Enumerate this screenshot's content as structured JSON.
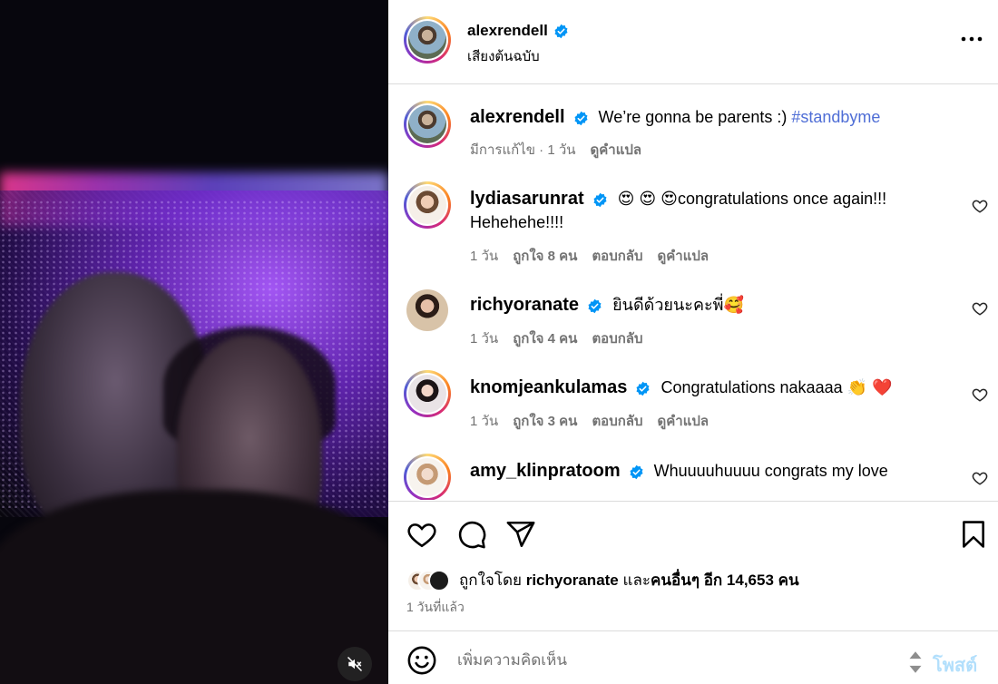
{
  "post": {
    "author": "alexrendell",
    "audio_label": "เสียงต้นฉบับ"
  },
  "caption": {
    "username": "alexrendell",
    "text": "We’re gonna be parents :) ",
    "hashtag": "#standbyme",
    "edited_label": "มีการแก้ไข",
    "time": "1 วัน",
    "translate": "ดูคำแปล"
  },
  "comments": [
    {
      "username": "lydiasarunrat",
      "emoji": "😍 😍 😍",
      "text": "congratulations once again!!! Hehehehe!!!!",
      "time": "1 วัน",
      "likes": "ถูกใจ 8 คน",
      "reply": "ตอบกลับ",
      "translate": "ดูคำแปล"
    },
    {
      "username": "richyoranate",
      "text": "ยินดีด้วยนะคะพี่",
      "emoji": "🥰",
      "time": "1 วัน",
      "likes": "ถูกใจ 4 คน",
      "reply": "ตอบกลับ"
    },
    {
      "username": "knomjeankulamas",
      "text": "Congratulations nakaaaa ",
      "emoji": "👏 ❤️",
      "time": "1 วัน",
      "likes": "ถูกใจ 3 คน",
      "reply": "ตอบกลับ",
      "translate": "ดูคำแปล"
    },
    {
      "username": "amy_klinpratoom",
      "text": "Whuuuuhuuuu congrats my love"
    }
  ],
  "likes": {
    "prefix": "ถูกใจโดย",
    "user": "richyoranate",
    "conj": "และ",
    "others": "คนอื่นๆ อีก 14,653 คน"
  },
  "posted_time": "1 วันที่แล้ว",
  "composer": {
    "placeholder": "เพิ่มความคิดเห็น",
    "post_label": "โพสต์"
  },
  "colors": {
    "link": "#4f6ed6",
    "verified": "#0095f6",
    "muted_text": "#737373",
    "post_disabled": "#b2dffc"
  },
  "icons": [
    "mute-icon",
    "verified-icon",
    "more-icon",
    "heart-icon",
    "comment-icon",
    "share-icon",
    "bookmark-icon",
    "emoji-icon",
    "sort-icon"
  ]
}
